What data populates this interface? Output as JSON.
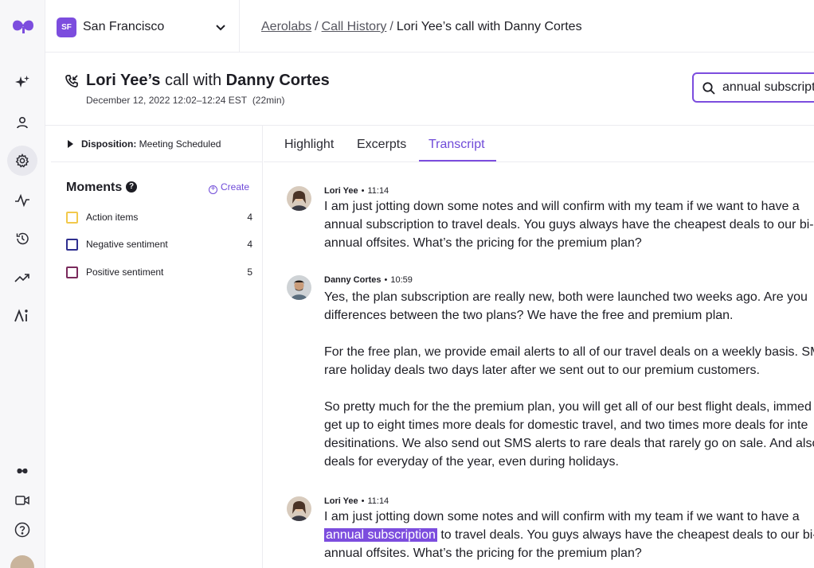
{
  "workspace": {
    "badge": "SF",
    "name": "San Francisco"
  },
  "breadcrumb": {
    "org": "Aerolabs",
    "section": "Call History",
    "current": "Lori Yee’s call with Danny Cortes"
  },
  "call": {
    "caller": "Lori Yee’s",
    "connector": "call with",
    "callee": "Danny Cortes",
    "datetime": "December 12, 2022 12:02–12:24 EST",
    "duration": "(22min)"
  },
  "search": {
    "value": "annual subscription"
  },
  "disposition": {
    "label": "Disposition:",
    "value": "Meeting Scheduled"
  },
  "moments": {
    "title": "Moments",
    "create_label": "Create",
    "items": [
      {
        "label": "Action items",
        "count": "4",
        "color": "#f2c94c"
      },
      {
        "label": "Negative sentiment",
        "count": "4",
        "color": "#2f2f8f"
      },
      {
        "label": "Positive sentiment",
        "count": "5",
        "color": "#7a2a5c"
      }
    ]
  },
  "tabs": [
    "Highlight",
    "Excerpts",
    "Transcript"
  ],
  "active_tab": "Transcript",
  "transcript": [
    {
      "speaker": "Lori Yee",
      "time": "11:14",
      "lines": [
        "I am just jotting down some notes and will confirm with my team if we want to have a",
        "annual subscription to travel deals. You guys always have the cheapest deals to our bi-",
        "annual offsites. What’s the pricing for the premium plan?"
      ]
    },
    {
      "speaker": "Danny Cortes",
      "time": "10:59",
      "paragraphs": [
        [
          "Yes, the plan subscription are really new, both were launched two weeks ago. Are you",
          "differences between the two plans? We have the free and premium plan."
        ],
        [
          "For the free plan, we provide email alerts to all of our travel deals on a weekly basis. SM",
          "rare holiday deals two days later after we sent out to our premium customers."
        ],
        [
          "So pretty much for the the premium plan, you will get all of our best flight deals, immed",
          "get up to eight times more deals for domestic travel, and two times more deals for inte",
          "desitinations. We also send out SMS alerts to rare deals that rarely go on sale. And also",
          "deals for everyday of the year, even during holidays."
        ]
      ]
    },
    {
      "speaker": "Lori Yee",
      "time": "11:14",
      "line1": "I am just jotting down some notes and will confirm with my team if we want to have a",
      "highlight": "annual subscription",
      "line2_rest": " to travel deals. You guys always have the cheapest deals to our bi-",
      "line3": "annual offsites. What’s the pricing for the premium plan?"
    }
  ],
  "colors": {
    "accent": "#7c4dde"
  },
  "icons": [
    "app-logo-icon",
    "sparkle-icon",
    "person-icon",
    "gear-icon",
    "activity-icon",
    "history-icon",
    "trend-icon",
    "ai-icon",
    "mini-logo-icon",
    "video-icon",
    "help-icon",
    "phone-incoming-icon",
    "search-icon",
    "chevron-down-icon"
  ]
}
